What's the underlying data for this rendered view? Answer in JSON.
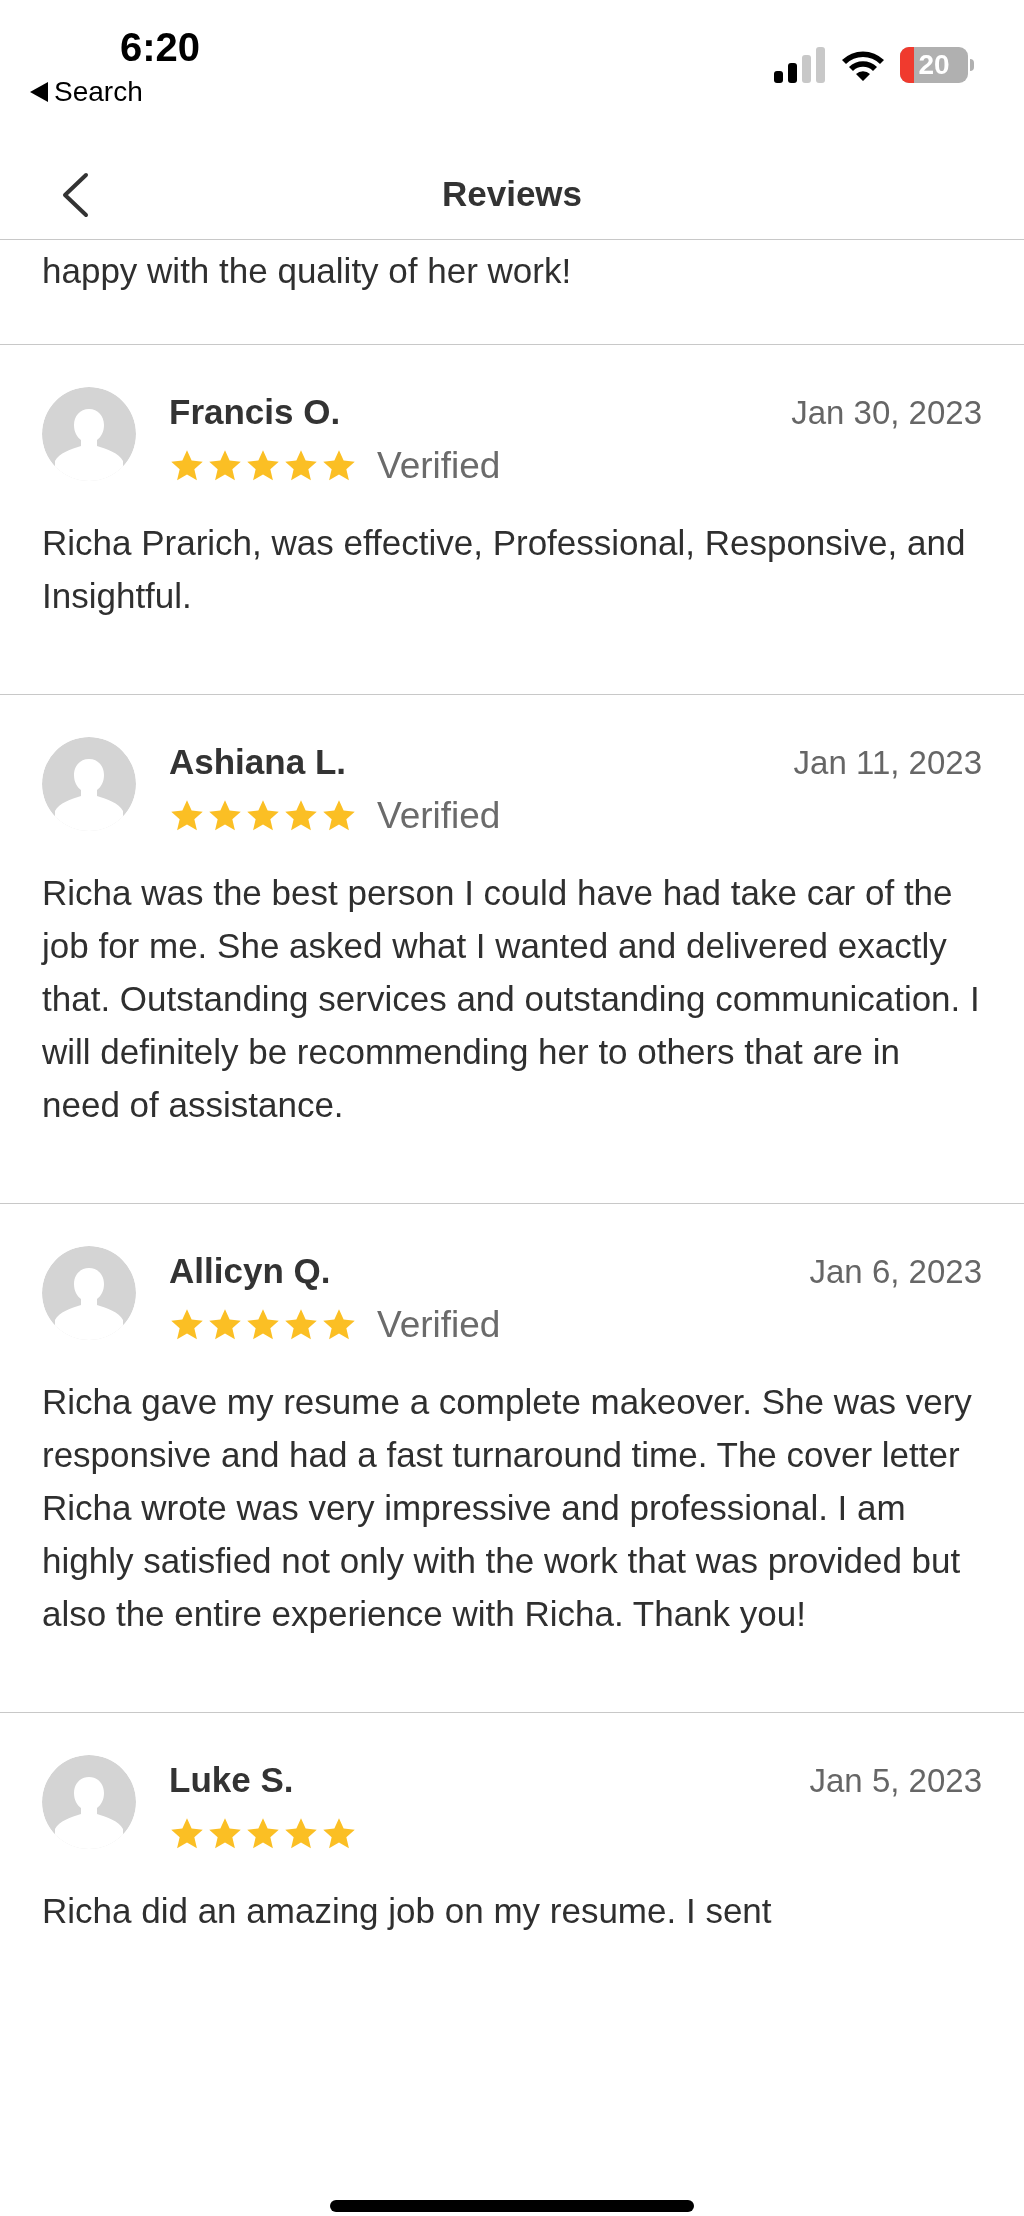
{
  "status_bar": {
    "time": "6:20",
    "back_label": "Search",
    "battery": "20"
  },
  "header": {
    "title": "Reviews"
  },
  "previous_review_tail": "happy with the quality of her work!",
  "reviews": [
    {
      "name": "Francis O.",
      "date": "Jan 30, 2023",
      "stars": 5,
      "verified_label": "Verified",
      "body": "Richa Prarich, was effective, Professional, Responsive, and Insightful."
    },
    {
      "name": "Ashiana L.",
      "date": "Jan 11, 2023",
      "stars": 5,
      "verified_label": "Verified",
      "body": "Richa was the best person I could have had take car of the job for me. She asked what I wanted and delivered exactly that. Outstanding services and outstanding communication. I will definitely be recommending her to others that are in need of assistance."
    },
    {
      "name": "Allicyn Q.",
      "date": "Jan 6, 2023",
      "stars": 5,
      "verified_label": "Verified",
      "body": "Richa gave my resume a complete makeover. She was very responsive and had a fast turnaround time.  The cover letter Richa wrote was very impressive and professional. I am highly satisfied not only with the work that was provided but also the entire experience with Richa. Thank you!"
    },
    {
      "name": "Luke S.",
      "date": "Jan 5, 2023",
      "stars": 5,
      "body": "Richa did an amazing job on my resume. I sent"
    }
  ]
}
